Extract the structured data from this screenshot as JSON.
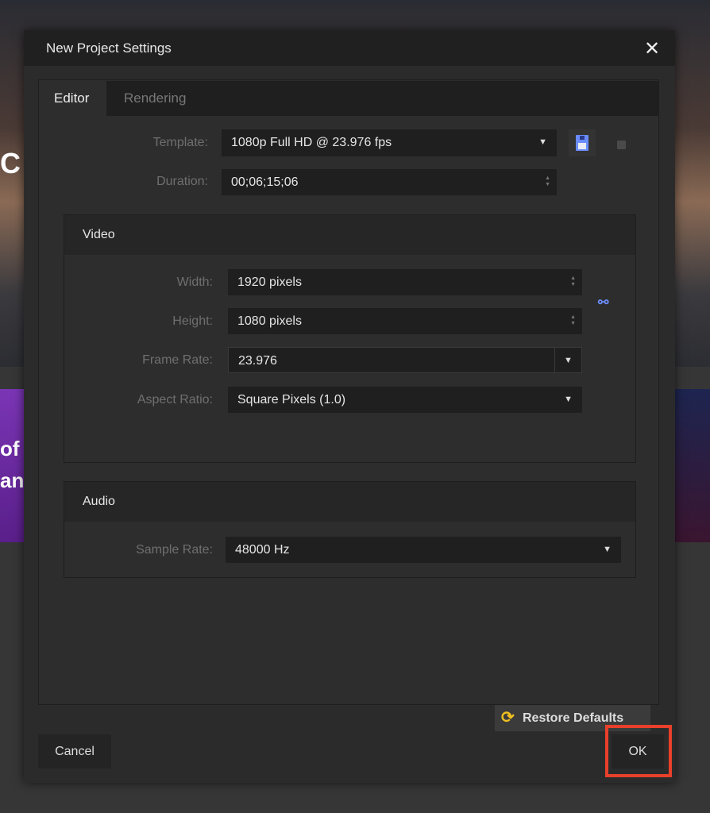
{
  "background": {
    "fragments": [
      "C",
      "of l",
      "an"
    ]
  },
  "dialog": {
    "title": "New Project Settings",
    "tabs": [
      {
        "label": "Editor",
        "active": true
      },
      {
        "label": "Rendering",
        "active": false
      }
    ],
    "template": {
      "label": "Template:",
      "value": "1080p Full HD @ 23.976 fps",
      "save_icon": "floppy-disk-icon",
      "delete_icon": "square-icon"
    },
    "duration": {
      "label": "Duration:",
      "value": "00;06;15;06"
    },
    "video": {
      "header": "Video",
      "width": {
        "label": "Width:",
        "value": "1920 pixels"
      },
      "height": {
        "label": "Height:",
        "value": "1080 pixels"
      },
      "link_icon": "chain-link-icon",
      "frame_rate": {
        "label": "Frame Rate:",
        "value": "23.976"
      },
      "aspect_ratio": {
        "label": "Aspect Ratio:",
        "value": "Square Pixels (1.0)"
      }
    },
    "audio": {
      "header": "Audio",
      "sample_rate": {
        "label": "Sample Rate:",
        "value": "48000 Hz"
      }
    },
    "restore_defaults": "Restore Defaults",
    "cancel": "Cancel",
    "ok": "OK",
    "colors": {
      "highlight": "#e8402a",
      "restore_icon": "#f0c020",
      "link_icon": "#6a8cff"
    }
  }
}
